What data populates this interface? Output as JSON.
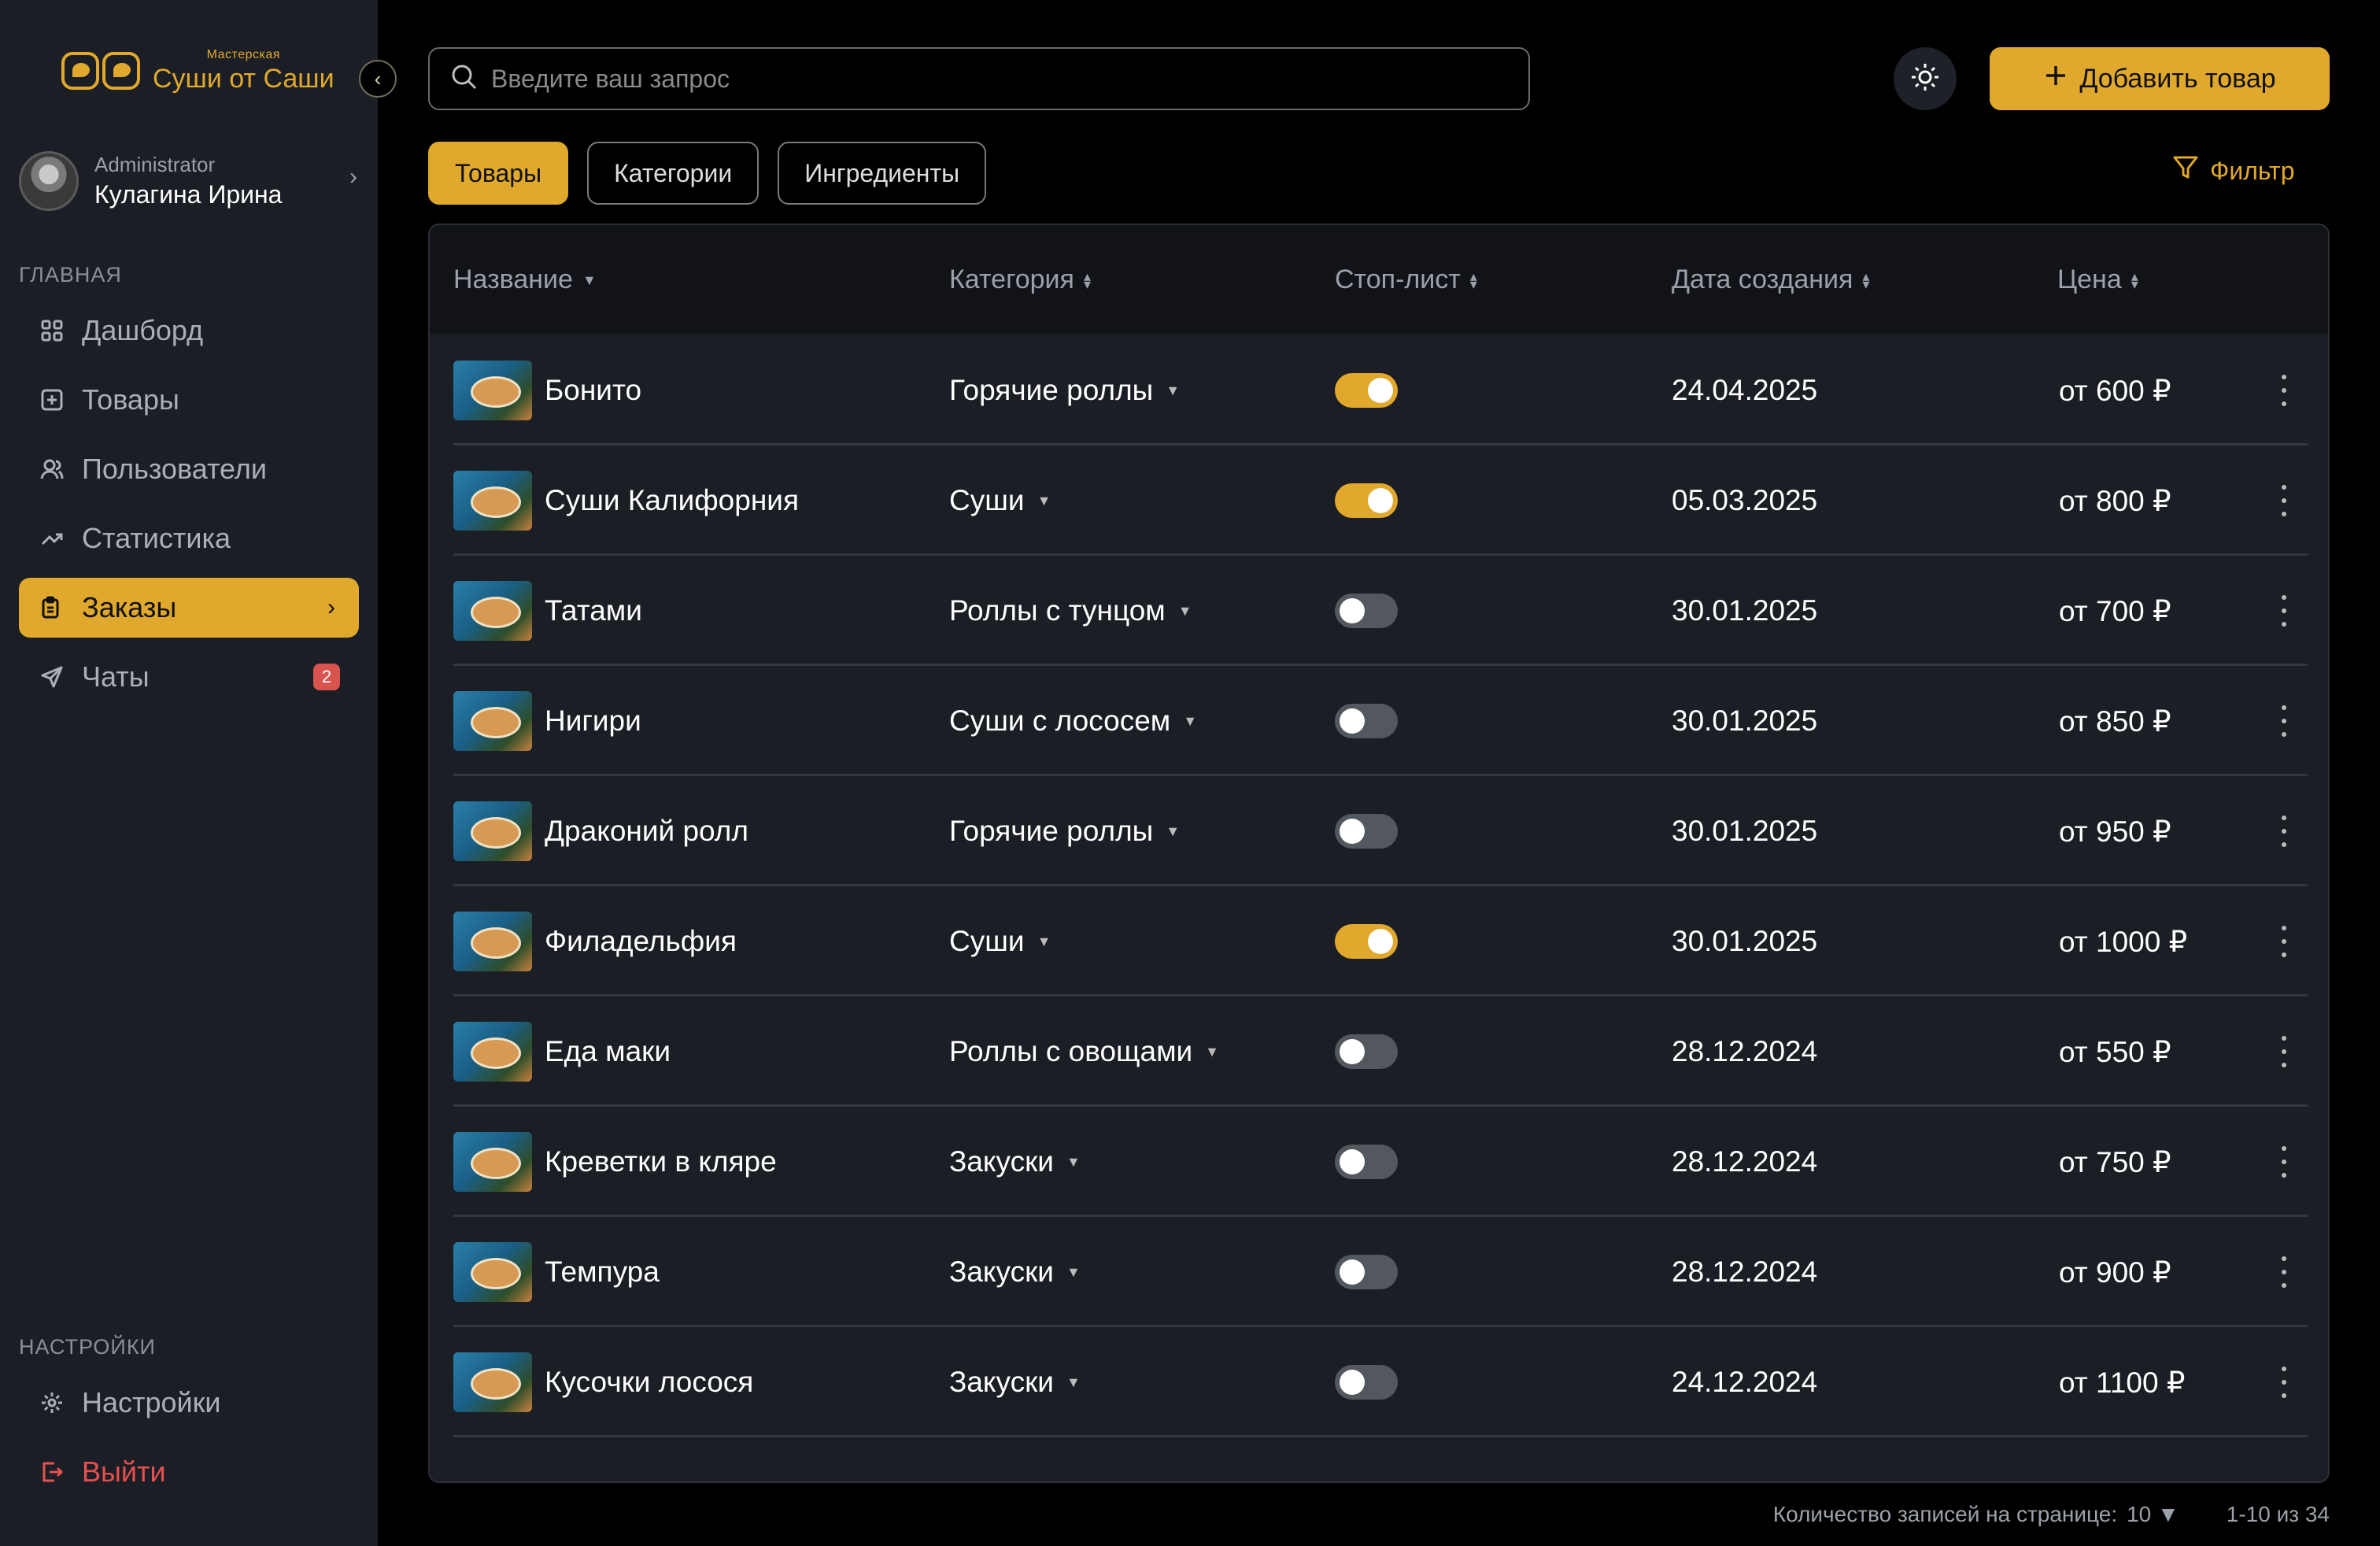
{
  "brand": {
    "small": "Мастерская",
    "big": "Суши от Саши",
    "accent": "#e0a92e"
  },
  "profile": {
    "role": "Administrator",
    "name": "Кулагина Ирина"
  },
  "nav": {
    "main_label": "ГЛАВНАЯ",
    "items": [
      {
        "label": "Дашборд",
        "icon": "grid-icon"
      },
      {
        "label": "Товары",
        "icon": "box-icon"
      },
      {
        "label": "Пользователи",
        "icon": "users-icon"
      },
      {
        "label": "Статистика",
        "icon": "trend-icon"
      },
      {
        "label": "Заказы",
        "icon": "clipboard-icon",
        "active": true
      },
      {
        "label": "Чаты",
        "icon": "send-icon",
        "badge": "2"
      }
    ],
    "settings_label": "НАСТРОЙКИ",
    "settings": "Настройки",
    "logout": "Выйти"
  },
  "search": {
    "placeholder": "Введите ваш запрос"
  },
  "actions": {
    "add": "Добавить товар",
    "filter": "Фильтр"
  },
  "tabs": [
    "Товары",
    "Категории",
    "Ингредиенты"
  ],
  "table": {
    "columns": [
      "Название",
      "Категория",
      "Стоп-лист",
      "Дата создания",
      "Цена"
    ],
    "rows": [
      {
        "name": "Бонито",
        "category": "Горячие роллы",
        "stop": true,
        "date": "24.04.2025",
        "price": "от 600 ₽"
      },
      {
        "name": "Суши Калифорния",
        "category": "Суши",
        "stop": true,
        "date": "05.03.2025",
        "price": "от 800 ₽"
      },
      {
        "name": "Татами",
        "category": "Роллы с тунцом",
        "stop": false,
        "date": "30.01.2025",
        "price": "от 700 ₽"
      },
      {
        "name": "Нигири",
        "category": "Суши с лососем",
        "stop": false,
        "date": "30.01.2025",
        "price": "от 850 ₽"
      },
      {
        "name": "Драконий ролл",
        "category": "Горячие роллы",
        "stop": false,
        "date": "30.01.2025",
        "price": "от 950 ₽"
      },
      {
        "name": "Филадельфия",
        "category": "Суши",
        "stop": true,
        "date": "30.01.2025",
        "price": "от 1000 ₽"
      },
      {
        "name": "Еда маки",
        "category": "Роллы с овощами",
        "stop": false,
        "date": "28.12.2024",
        "price": "от 550 ₽"
      },
      {
        "name": "Креветки в кляре",
        "category": "Закуски",
        "stop": false,
        "date": "28.12.2024",
        "price": "от 750 ₽"
      },
      {
        "name": "Темпура",
        "category": "Закуски",
        "stop": false,
        "date": "28.12.2024",
        "price": "от 900 ₽"
      },
      {
        "name": "Кусочки лосося",
        "category": "Закуски",
        "stop": false,
        "date": "24.12.2024",
        "price": "от 1100 ₽"
      }
    ]
  },
  "pagination": {
    "per_page_label": "Количество записей на странице:",
    "per_page": "10",
    "range": "1-10 из 34"
  }
}
